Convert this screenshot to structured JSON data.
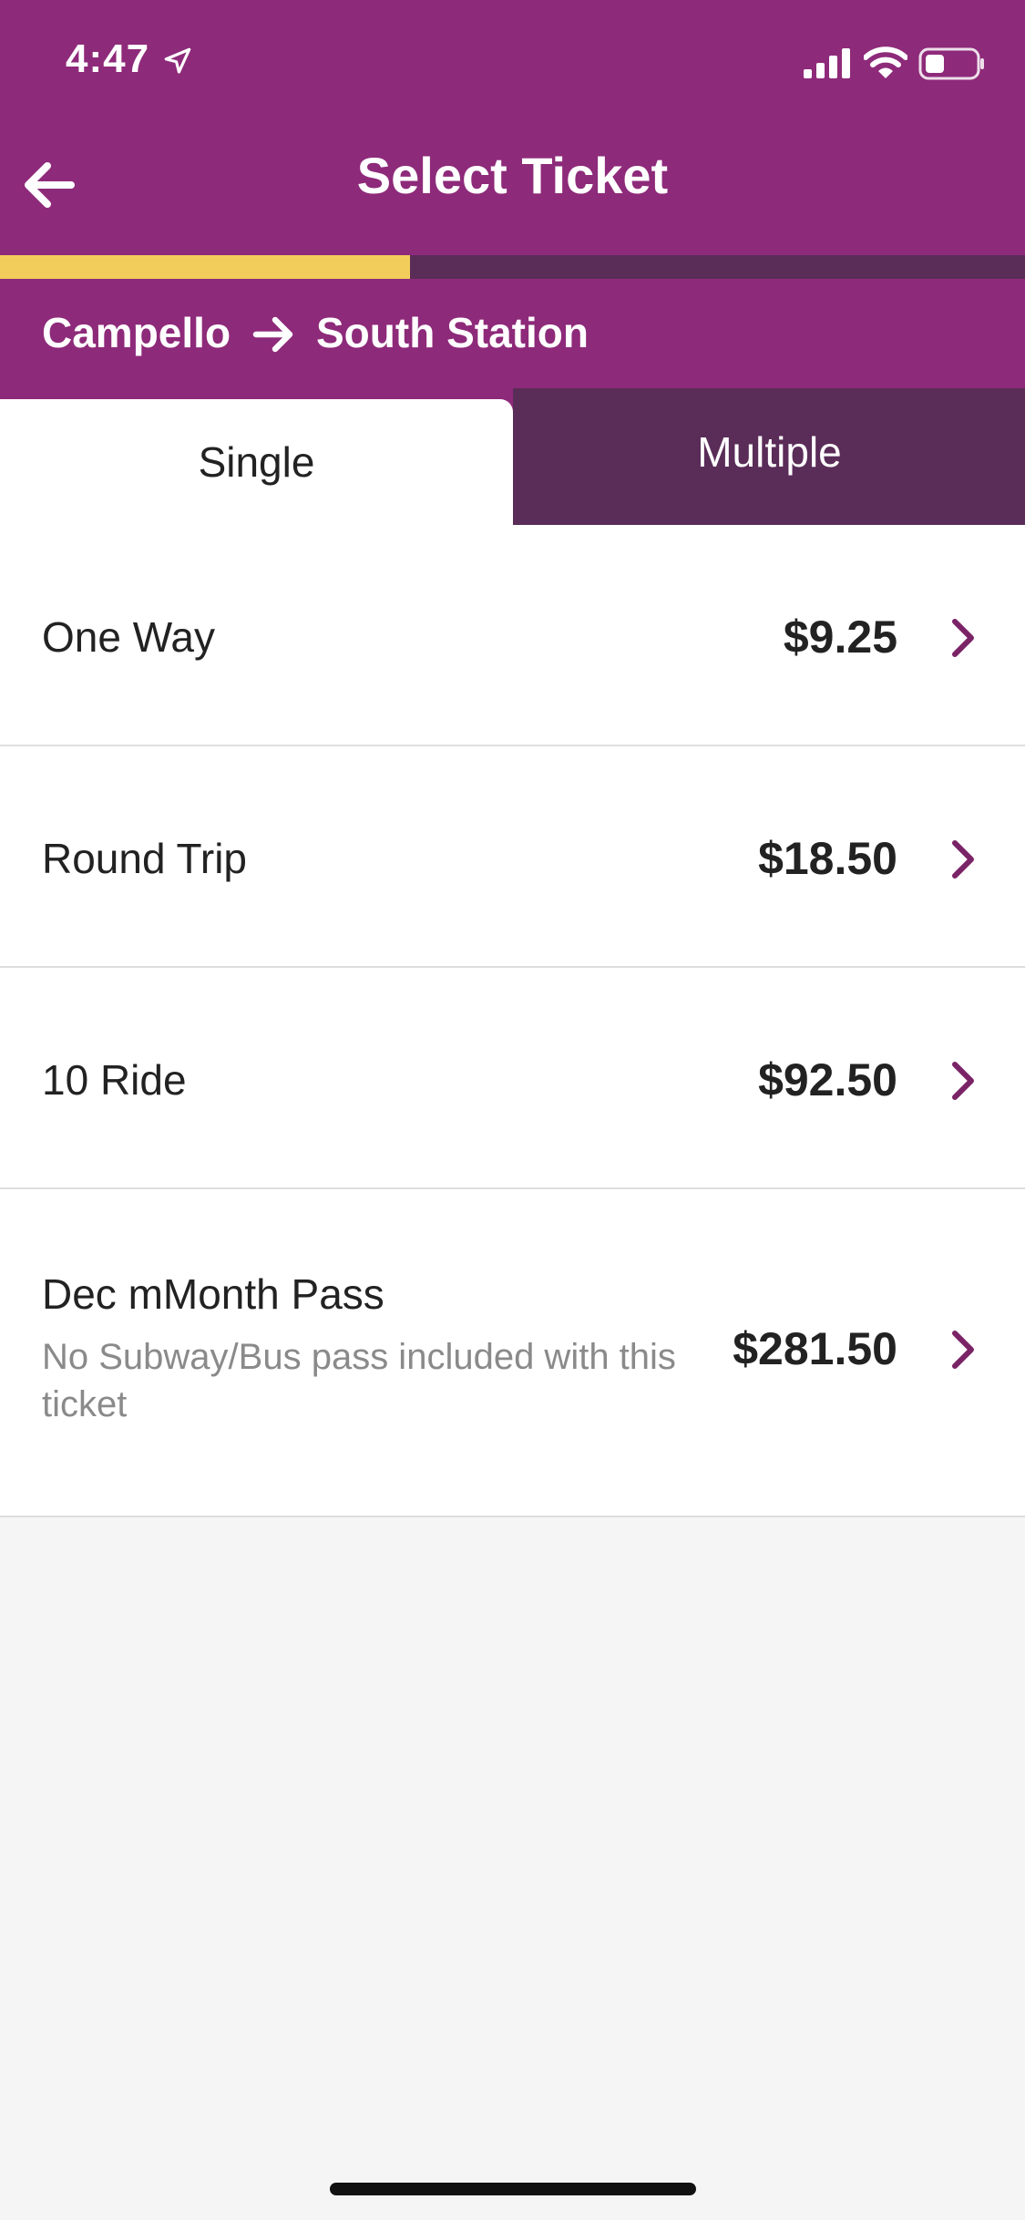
{
  "status_bar": {
    "time": "4:47"
  },
  "header": {
    "title": "Select Ticket",
    "progress_fraction": 0.4
  },
  "route": {
    "origin": "Campello",
    "destination": "South Station"
  },
  "tabs": [
    {
      "label": "Single",
      "selected": true
    },
    {
      "label": "Multiple",
      "selected": false
    }
  ],
  "tickets": [
    {
      "name": "One Way",
      "price": "$9.25"
    },
    {
      "name": "Round Trip",
      "price": "$18.50"
    },
    {
      "name": "10 Ride",
      "price": "$92.50"
    },
    {
      "name": "Dec mMonth Pass",
      "note": "No Subway/Bus pass included with this ticket",
      "price": "$281.50"
    }
  ],
  "colors": {
    "brand": "#8e2a7a",
    "brand_dark": "#5a2c58",
    "progress": "#f2cd5c",
    "chevron": "#7a2366"
  },
  "icons": [
    "location-arrow-icon",
    "cellular-signal-icon",
    "wifi-icon",
    "battery-icon",
    "back-arrow-icon",
    "route-arrow-icon",
    "chevron-right-icon"
  ]
}
